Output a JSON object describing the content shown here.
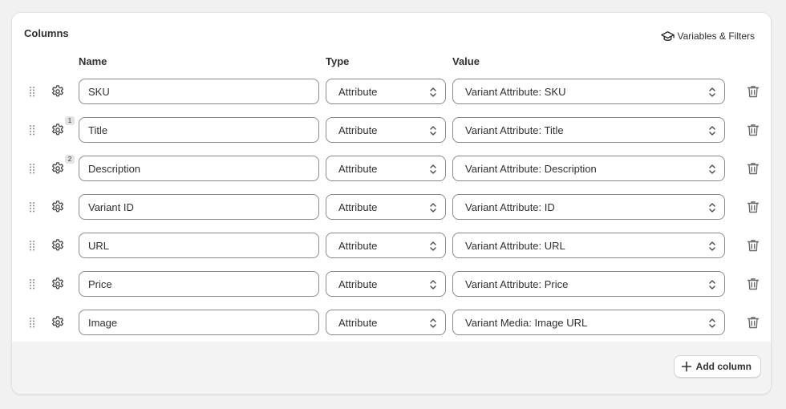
{
  "card": {
    "title": "Columns",
    "variables_filters_label": "Variables & Filters"
  },
  "headers": {
    "name": "Name",
    "type": "Type",
    "value": "Value"
  },
  "rows": [
    {
      "name": "SKU",
      "type": "Attribute",
      "value": "Variant Attribute: SKU",
      "badge": ""
    },
    {
      "name": "Title",
      "type": "Attribute",
      "value": "Variant Attribute: Title",
      "badge": "1"
    },
    {
      "name": "Description",
      "type": "Attribute",
      "value": "Variant Attribute: Description",
      "badge": "2"
    },
    {
      "name": "Variant ID",
      "type": "Attribute",
      "value": "Variant Attribute: ID",
      "badge": ""
    },
    {
      "name": "URL",
      "type": "Attribute",
      "value": "Variant Attribute: URL",
      "badge": ""
    },
    {
      "name": "Price",
      "type": "Attribute",
      "value": "Variant Attribute: Price",
      "badge": ""
    },
    {
      "name": "Image",
      "type": "Attribute",
      "value": "Variant Media: Image URL",
      "badge": ""
    }
  ],
  "footer": {
    "add_column_label": "Add column"
  },
  "icons": {
    "drag": "drag-handle-icon",
    "settings": "gear-icon",
    "select": "chevron-up-down-icon",
    "delete": "trash-icon",
    "variables": "graduation-cap-icon",
    "add": "plus-icon"
  }
}
